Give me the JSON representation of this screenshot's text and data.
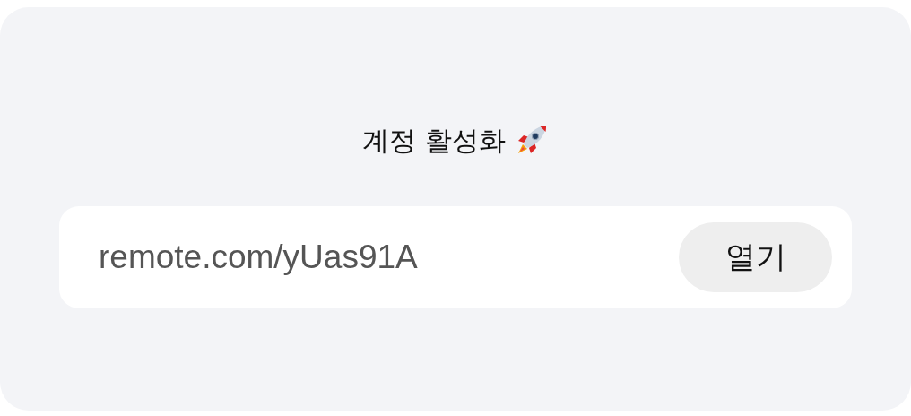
{
  "card": {
    "title": "계정 활성화",
    "link": {
      "value": "remote.com/yUas91A",
      "button": "열기"
    }
  }
}
